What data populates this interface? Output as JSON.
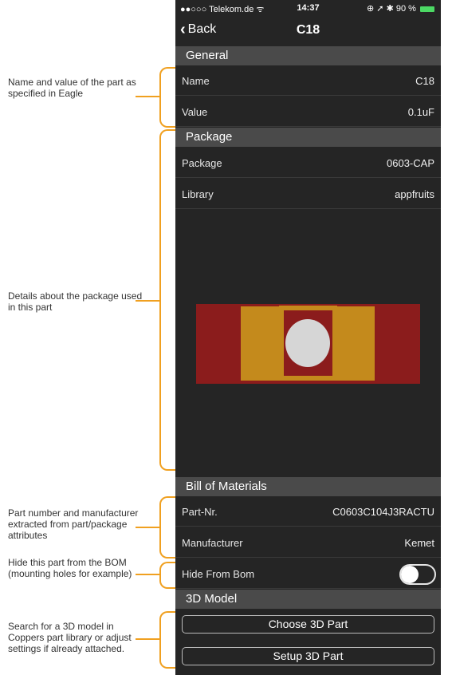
{
  "status_bar": {
    "carrier": "●●○○○ Telekom.de ᯤ",
    "time": "14:37",
    "right": "⊕ ➚ ✱ 90 %"
  },
  "nav": {
    "back_label": "Back",
    "title": "C18"
  },
  "sections": {
    "general": "General",
    "package": "Package",
    "bom": "Bill of Materials",
    "model3d": "3D Model"
  },
  "rows": {
    "name": {
      "label": "Name",
      "value": "C18"
    },
    "value": {
      "label": "Value",
      "value": "0.1uF"
    },
    "package": {
      "label": "Package",
      "value": "0603-CAP"
    },
    "library": {
      "label": "Library",
      "value": "appfruits"
    },
    "part_nr": {
      "label": "Part-Nr.",
      "value": "C0603C104J3RACTU"
    },
    "manufacturer": {
      "label": "Manufacturer",
      "value": "Kemet"
    },
    "hide_from_bom": {
      "label": "Hide From Bom",
      "checked": false
    }
  },
  "buttons": {
    "choose_3d": "Choose 3D Part",
    "setup_3d": "Setup 3D Part"
  },
  "annotations": {
    "name_value": "Name and value of the part as specified in Eagle",
    "package": "Details about the package used in this part",
    "part_number": "Part number and manufacturer extracted from part/package attributes",
    "hide": "Hide this part from the BOM (mounting holes for example)",
    "search_3d": "Search for a 3D model in Coppers part library or adjust settings if already attached."
  },
  "colors": {
    "accent_annotation": "#f0a020",
    "package_red": "#8b1c1c",
    "package_pad": "#c48a1c",
    "package_hole": "#d6d6d6"
  }
}
